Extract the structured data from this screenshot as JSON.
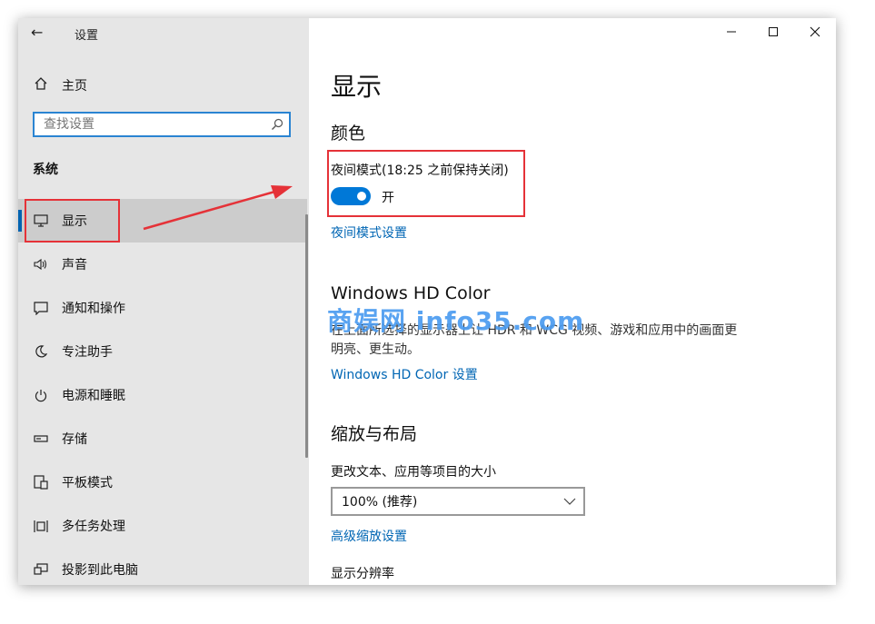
{
  "window": {
    "title": "设置",
    "back_glyph": "←"
  },
  "controls": {
    "minimize": "—",
    "maximize": "☐",
    "close": "✕"
  },
  "sidebar": {
    "home_label": "主页",
    "search_placeholder": "查找设置",
    "section_title": "系统",
    "items": [
      {
        "label": "显示",
        "icon": "monitor-icon",
        "selected": true
      },
      {
        "label": "声音",
        "icon": "speaker-icon"
      },
      {
        "label": "通知和操作",
        "icon": "message-icon"
      },
      {
        "label": "专注助手",
        "icon": "moon-icon"
      },
      {
        "label": "电源和睡眠",
        "icon": "power-icon"
      },
      {
        "label": "存储",
        "icon": "storage-icon"
      },
      {
        "label": "平板模式",
        "icon": "tablet-icon"
      },
      {
        "label": "多任务处理",
        "icon": "multitask-icon"
      },
      {
        "label": "投影到此电脑",
        "icon": "project-icon"
      }
    ]
  },
  "main": {
    "title": "显示",
    "color_heading": "颜色",
    "night_light_label": "夜间模式(18:25 之前保持关闭)",
    "toggle_on": true,
    "toggle_state": "开",
    "night_light_settings_link": "夜间模式设置",
    "hd_heading": "Windows HD Color",
    "hd_description": "在上面所选择的显示器上让 HDR 和 WCG 视频、游戏和应用中的画面更明亮、更生动。",
    "hd_link": "Windows HD Color 设置",
    "scale_heading": "缩放与布局",
    "scale_label": "更改文本、应用等项目的大小",
    "scale_value": "100% (推荐)",
    "advanced_scaling_link": "高级缩放设置",
    "resolution_label": "显示分辨率"
  },
  "annotation": {
    "color": "#e53238",
    "watermark": "商娱网 info35.com"
  },
  "accent": {
    "toggle": "#0078d7",
    "link": "#0066b4",
    "selection_bar": "#0063b1"
  }
}
